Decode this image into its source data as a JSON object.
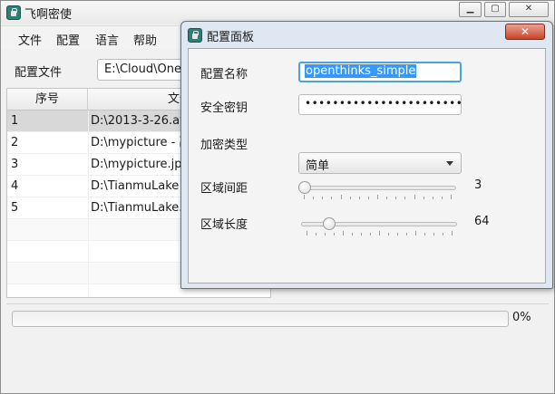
{
  "main_window": {
    "title": "飞啊密使",
    "caption": {
      "minimize": "▁",
      "maximize": "▢",
      "close": "✕"
    }
  },
  "menu": [
    "文件",
    "配置",
    "语言",
    "帮助"
  ],
  "config_file": {
    "label": "配置文件",
    "value": "E:\\Cloud\\OneD"
  },
  "table": {
    "headers": [
      "序号",
      "文件"
    ],
    "rows": [
      {
        "index": "1",
        "path": "D:\\2013-3-26.av",
        "selected": true
      },
      {
        "index": "2",
        "path": "D:\\mypicture - 副",
        "selected": false
      },
      {
        "index": "3",
        "path": "D:\\mypicture.jpg",
        "selected": false
      },
      {
        "index": "4",
        "path": "D:\\TianmuLake -",
        "selected": false
      },
      {
        "index": "5",
        "path": "D:\\TianmuLake.jp",
        "selected": false
      }
    ]
  },
  "progress": {
    "value": 0,
    "text": "0%"
  },
  "dialog": {
    "title": "配置面板",
    "close_label": "✕",
    "name": {
      "label": "配置名称",
      "value": "openthinks_simple"
    },
    "key": {
      "label": "安全密钥",
      "value": "•••••••••••••••••••••••••"
    },
    "encryption": {
      "label": "加密类型",
      "selected": "简单"
    },
    "interval": {
      "label": "区域间距",
      "value": "3",
      "level": 0.0
    },
    "length": {
      "label": "区域长度",
      "value": "64",
      "level": 0.15
    }
  },
  "colors": {
    "accent": "#3399ff",
    "focus": "#4aa3df",
    "close": "#c9442a"
  },
  "icons": {
    "app": "app-icon",
    "dropdown": "chevron-down-icon"
  }
}
